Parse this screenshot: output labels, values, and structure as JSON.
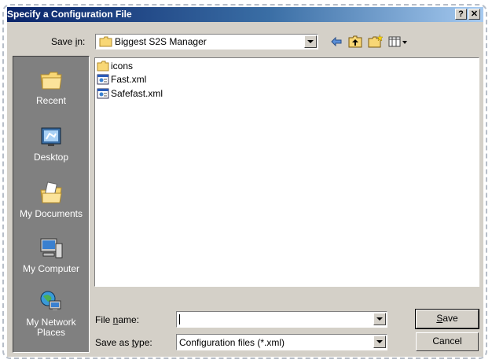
{
  "window": {
    "title": "Specify a Configuration File",
    "help_label": "?",
    "close_label": "✕"
  },
  "toolbar": {
    "save_in_label_pre": "Save ",
    "save_in_label_key": "i",
    "save_in_label_post": "n:",
    "current_folder": "Biggest S2S Manager",
    "icons": [
      "back-arrow-icon",
      "up-folder-icon",
      "new-folder-icon",
      "view-menu-icon"
    ]
  },
  "places": [
    {
      "label": "Recent",
      "icon": "recent-icon"
    },
    {
      "label": "Desktop",
      "icon": "desktop-icon"
    },
    {
      "label": "My Documents",
      "icon": "my-documents-icon"
    },
    {
      "label": "My Computer",
      "icon": "my-computer-icon"
    },
    {
      "label": "My Network Places",
      "icon": "network-places-icon"
    }
  ],
  "files": [
    {
      "name": "icons",
      "type": "folder"
    },
    {
      "name": "Fast.xml",
      "type": "xml"
    },
    {
      "name": "Safefast.xml",
      "type": "xml"
    }
  ],
  "form": {
    "file_name_label_pre": "File ",
    "file_name_label_key": "n",
    "file_name_label_post": "ame:",
    "file_name_value": "",
    "save_as_type_label_pre": "Save as ",
    "save_as_type_label_key": "t",
    "save_as_type_label_post": "ype:",
    "save_as_type_value": "Configuration files (*.xml)"
  },
  "buttons": {
    "save_key": "S",
    "save_rest": "ave",
    "cancel": "Cancel"
  }
}
